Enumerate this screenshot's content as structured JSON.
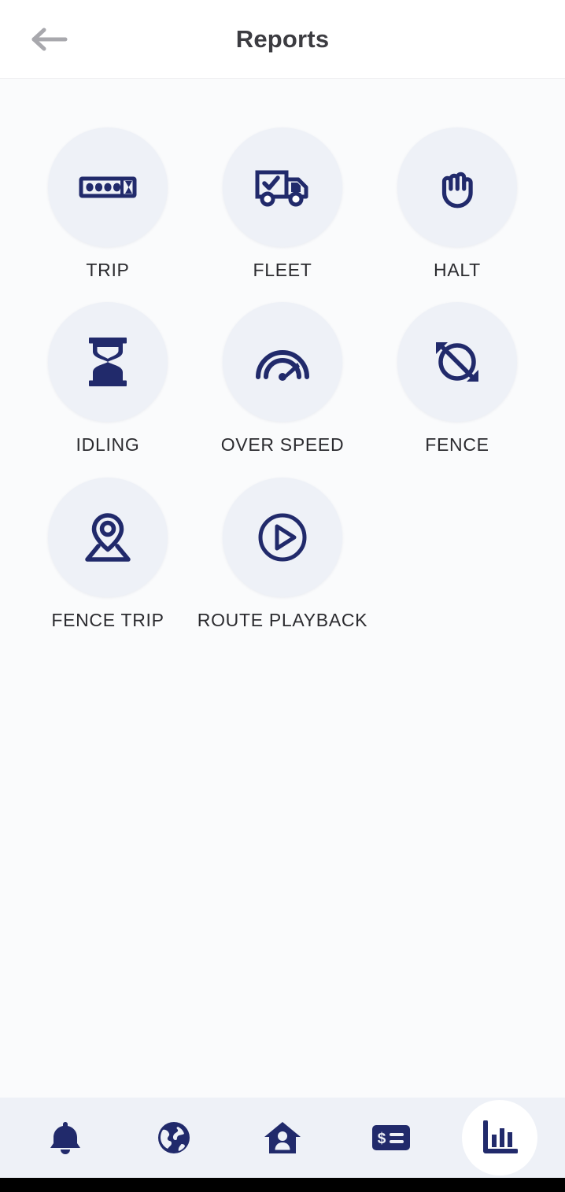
{
  "header": {
    "title": "Reports",
    "back_icon": "arrow-left-icon"
  },
  "reports": {
    "tiles": [
      {
        "label": "TRIP",
        "icon": "trip-meter-icon"
      },
      {
        "label": "FLEET",
        "icon": "delivery-truck-check-icon"
      },
      {
        "label": "HALT",
        "icon": "raised-hand-icon"
      },
      {
        "label": "IDLING",
        "icon": "hourglass-icon"
      },
      {
        "label": "OVER SPEED",
        "icon": "speedometer-icon"
      },
      {
        "label": "FENCE",
        "icon": "geofence-radius-icon"
      },
      {
        "label": "FENCE TRIP",
        "icon": "map-pin-icon"
      },
      {
        "label": "ROUTE PLAYBACK",
        "icon": "play-circle-icon"
      }
    ]
  },
  "bottom_nav": {
    "items": [
      {
        "name": "notifications",
        "icon": "bell-icon",
        "active": false
      },
      {
        "name": "map",
        "icon": "globe-icon",
        "active": false
      },
      {
        "name": "home",
        "icon": "home-user-icon",
        "active": false
      },
      {
        "name": "billing",
        "icon": "payment-card-icon",
        "active": false
      },
      {
        "name": "reports",
        "icon": "bar-chart-icon",
        "active": true
      }
    ]
  },
  "colors": {
    "brand_navy": "#212a6b",
    "circle_bg": "#eef1f7",
    "page_bg": "#fafbfc",
    "header_text": "#3c3c41",
    "label_text": "#2b2b2f",
    "back_arrow": "#a8a8ad"
  }
}
